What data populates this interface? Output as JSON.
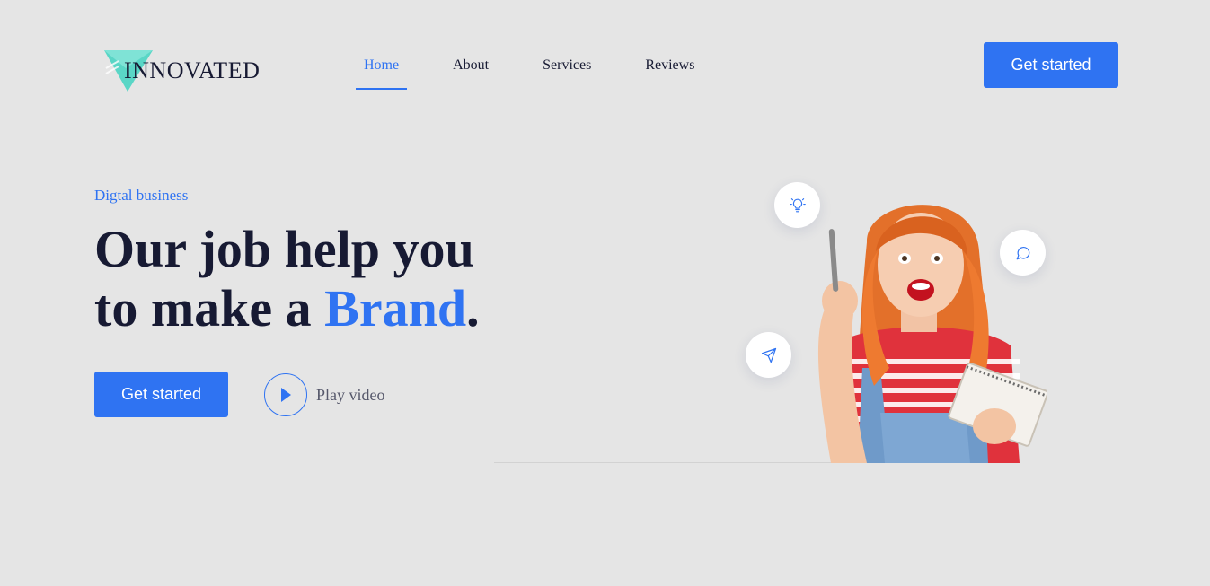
{
  "colors": {
    "background": "#e5e5e5",
    "accent": "#2f73f2",
    "heading": "#171a33",
    "logo_teal": "#5ad6c6"
  },
  "brand": {
    "name": "INNOVATED",
    "logo_icon": "paper-plane-triangle-icon"
  },
  "nav": {
    "items": [
      {
        "label": "Home",
        "active": true
      },
      {
        "label": "About",
        "active": false
      },
      {
        "label": "Services",
        "active": false
      },
      {
        "label": "Reviews",
        "active": false
      }
    ]
  },
  "header": {
    "cta_label": "Get started"
  },
  "hero": {
    "eyebrow": "Digtal business",
    "headline_line1": "Our job help you",
    "headline_line2_prefix": "to make a ",
    "headline_accent": "Brand",
    "headline_suffix": ".",
    "cta_label": "Get started",
    "play_label": "Play video",
    "play_icon": "play-icon",
    "bubbles": [
      {
        "icon": "lightbulb-icon"
      },
      {
        "icon": "chat-bubble-icon"
      },
      {
        "icon": "send-icon"
      }
    ]
  }
}
